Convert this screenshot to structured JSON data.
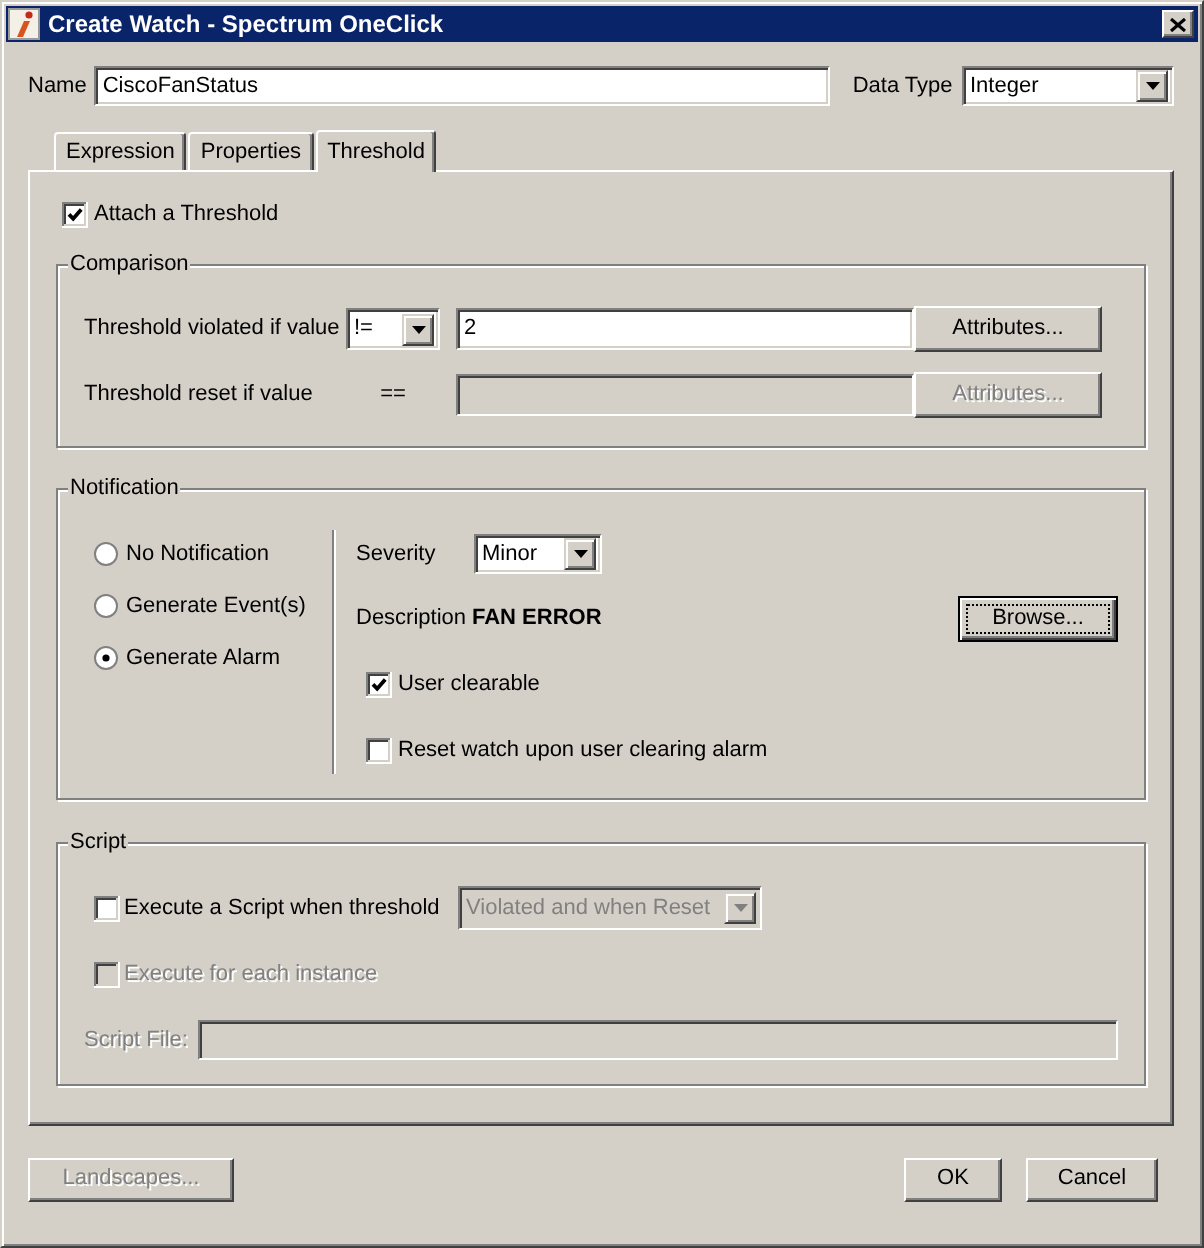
{
  "window": {
    "title": "Create Watch - Spectrum OneClick"
  },
  "name_field": {
    "label": "Name",
    "value": "CiscoFanStatus"
  },
  "data_type": {
    "label": "Data Type",
    "value": "Integer"
  },
  "tabs": [
    {
      "label": "Expression",
      "selected": false
    },
    {
      "label": "Properties",
      "selected": false
    },
    {
      "label": "Threshold",
      "selected": true
    }
  ],
  "attach_threshold": {
    "label": "Attach a Threshold",
    "checked": true
  },
  "comparison": {
    "title": "Comparison",
    "rows": [
      {
        "label": "Threshold violated if value",
        "kind": "dropdown",
        "operator": "!=",
        "value": "2",
        "button": "Attributes...",
        "disabled": false
      },
      {
        "label": "Threshold reset if value",
        "kind": "fixed",
        "operator": "==",
        "button": "Attributes...",
        "disabled": true
      }
    ]
  },
  "notification": {
    "title": "Notification",
    "options": [
      {
        "label": "No Notification",
        "selected": false
      },
      {
        "label": "Generate Event(s)",
        "selected": false
      },
      {
        "label": "Generate Alarm",
        "selected": true
      }
    ],
    "severity": {
      "label": "Severity",
      "value": "Minor"
    },
    "description": {
      "label": "Description",
      "value": "FAN ERROR"
    },
    "browse_button": {
      "label": "Browse...",
      "focused": true
    },
    "checkboxes": [
      {
        "label": "User clearable",
        "checked": true
      },
      {
        "label": "Reset watch upon user clearing alarm",
        "checked": false
      }
    ]
  },
  "script": {
    "title": "Script",
    "execute": {
      "label": "Execute a Script when threshold",
      "checked": false
    },
    "when": {
      "value": "Violated and when Reset",
      "disabled": true
    },
    "each_instance": {
      "label": "Execute for each instance",
      "checked": false,
      "disabled": true
    },
    "file": {
      "label": "Script File:",
      "disabled": true
    }
  },
  "buttons": [
    {
      "label": "Landscapes...",
      "disabled": true
    },
    {
      "label": "OK",
      "disabled": false
    },
    {
      "label": "Cancel",
      "disabled": false
    }
  ]
}
